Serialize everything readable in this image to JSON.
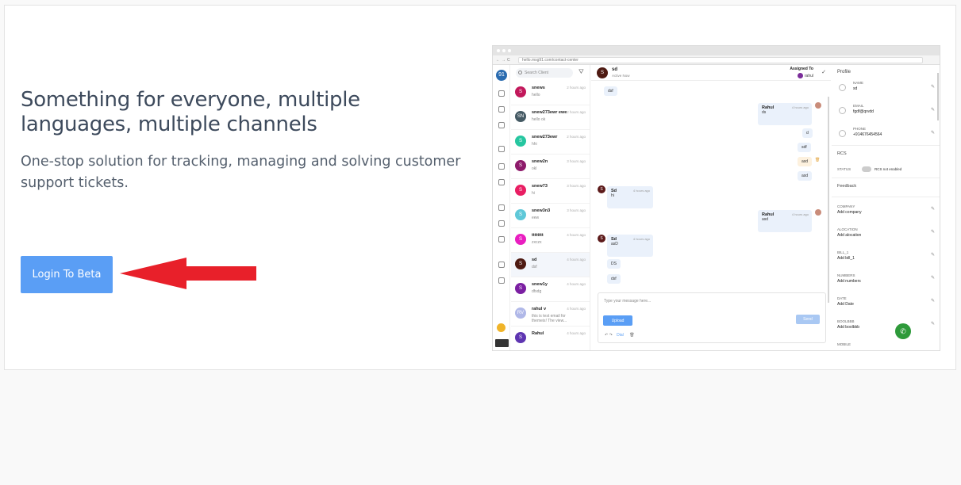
{
  "hero": {
    "headline": "Something for everyone, multiple languages, multiple channels",
    "subline": "One-stop solution for tracking, managing and solving customer support tickets.",
    "cta_label": "Login To Beta",
    "arrow_color": "#e8202a",
    "cta_color": "#5a9ef5"
  },
  "screenshot": {
    "url": "hello.msg91.com/contact-center",
    "logo_glyph": "91",
    "search_placeholder": "Search Client",
    "filter_glyph": "⛛",
    "contacts": [
      {
        "initial": "S",
        "name": "snews",
        "msg": "hello",
        "time": "2 hours ago",
        "color": "#c2185b"
      },
      {
        "initial": "SN",
        "name": "snew273ewr ewe",
        "msg": "hello ok",
        "time": "2 hours ago",
        "color": "#455a64"
      },
      {
        "initial": "S",
        "name": "snew273ewr",
        "msg": "hhi",
        "time": "2 hours ago",
        "color": "#26c6a0"
      },
      {
        "initial": "S",
        "name": "snew2n",
        "msg": "okl",
        "time": "3 hours ago",
        "color": "#8e1b6b"
      },
      {
        "initial": "S",
        "name": "snew73",
        "msg": "hi",
        "time": "3 hours ago",
        "color": "#e91e63"
      },
      {
        "initial": "S",
        "name": "snew3n3",
        "msg": "eew",
        "time": "3 hours ago",
        "color": "#5fc8d8"
      },
      {
        "initial": "S",
        "name": "tttttttt",
        "msg": "zxczx",
        "time": "4 hours ago",
        "color": "#e91ec0"
      },
      {
        "initial": "S",
        "name": "sd",
        "msg": "dsf",
        "time": "4 hours ago",
        "color": "#4e1a12"
      },
      {
        "initial": "S",
        "name": "snew1y",
        "msg": "dfsdg",
        "time": "4 hours ago",
        "color": "#7b1fa2"
      },
      {
        "initial": "RV",
        "name": "rahul v",
        "msg": "this is test email for themeis! The view...",
        "time": "4 hours ago",
        "color": "#b0b8e8"
      },
      {
        "initial": "S",
        "name": "Rahul",
        "msg": "",
        "time": "4 hours ago",
        "color": "#5e35b1"
      }
    ],
    "chat": {
      "contact_initial": "S",
      "contact_name": "sd",
      "contact_status": "Active Now",
      "assigned_label": "Assigned To",
      "assignee": "rahul",
      "check_glyph": "✓",
      "first_msg": "dsf",
      "agent_name": "Rahul",
      "agent_msg1": "ds",
      "agent_time": "4 hours ago",
      "small_msgs": [
        "d",
        "sdf",
        "asd",
        "asd"
      ],
      "client_name": "Sd",
      "client_msg1": "hi",
      "client_time": "4 hours ago",
      "agent_msg2": "asd",
      "client_msg2": "asD",
      "client_msg3": "DS",
      "client_msg4": "dsf",
      "composer_placeholder": "Type your message here...",
      "upload_label": "Upload",
      "send_label": "Send",
      "tools": "↶ ↷",
      "dial_label": "Dial",
      "trash_glyph": "🗑"
    },
    "profile": {
      "title": "Profile",
      "name_label": "NAME",
      "name_value": "sd",
      "email_label": "EMAIL",
      "email_value": "fgdf@qrvdd",
      "phone_label": "PHONE",
      "phone_value": "+914676454564",
      "rcs_label": "RCS",
      "status_label": "STATUS",
      "rcs_status": "RCS not enabled",
      "feedback_label": "Feedback",
      "fields": [
        {
          "label": "COMPANY",
          "value": "Add company"
        },
        {
          "label": "ALOCATION",
          "value": "Add alocation"
        },
        {
          "label": "BILL_1",
          "value": "Add bill_1"
        },
        {
          "label": "NUMBERS",
          "value": "Add numbers"
        },
        {
          "label": "DATE",
          "value": "Add Date"
        },
        {
          "label": "BOOLBBB",
          "value": "Add boolbbb"
        },
        {
          "label": "MOBILE",
          "value": ""
        }
      ],
      "edit_glyph": "✎",
      "phone_glyph": "✆"
    }
  }
}
